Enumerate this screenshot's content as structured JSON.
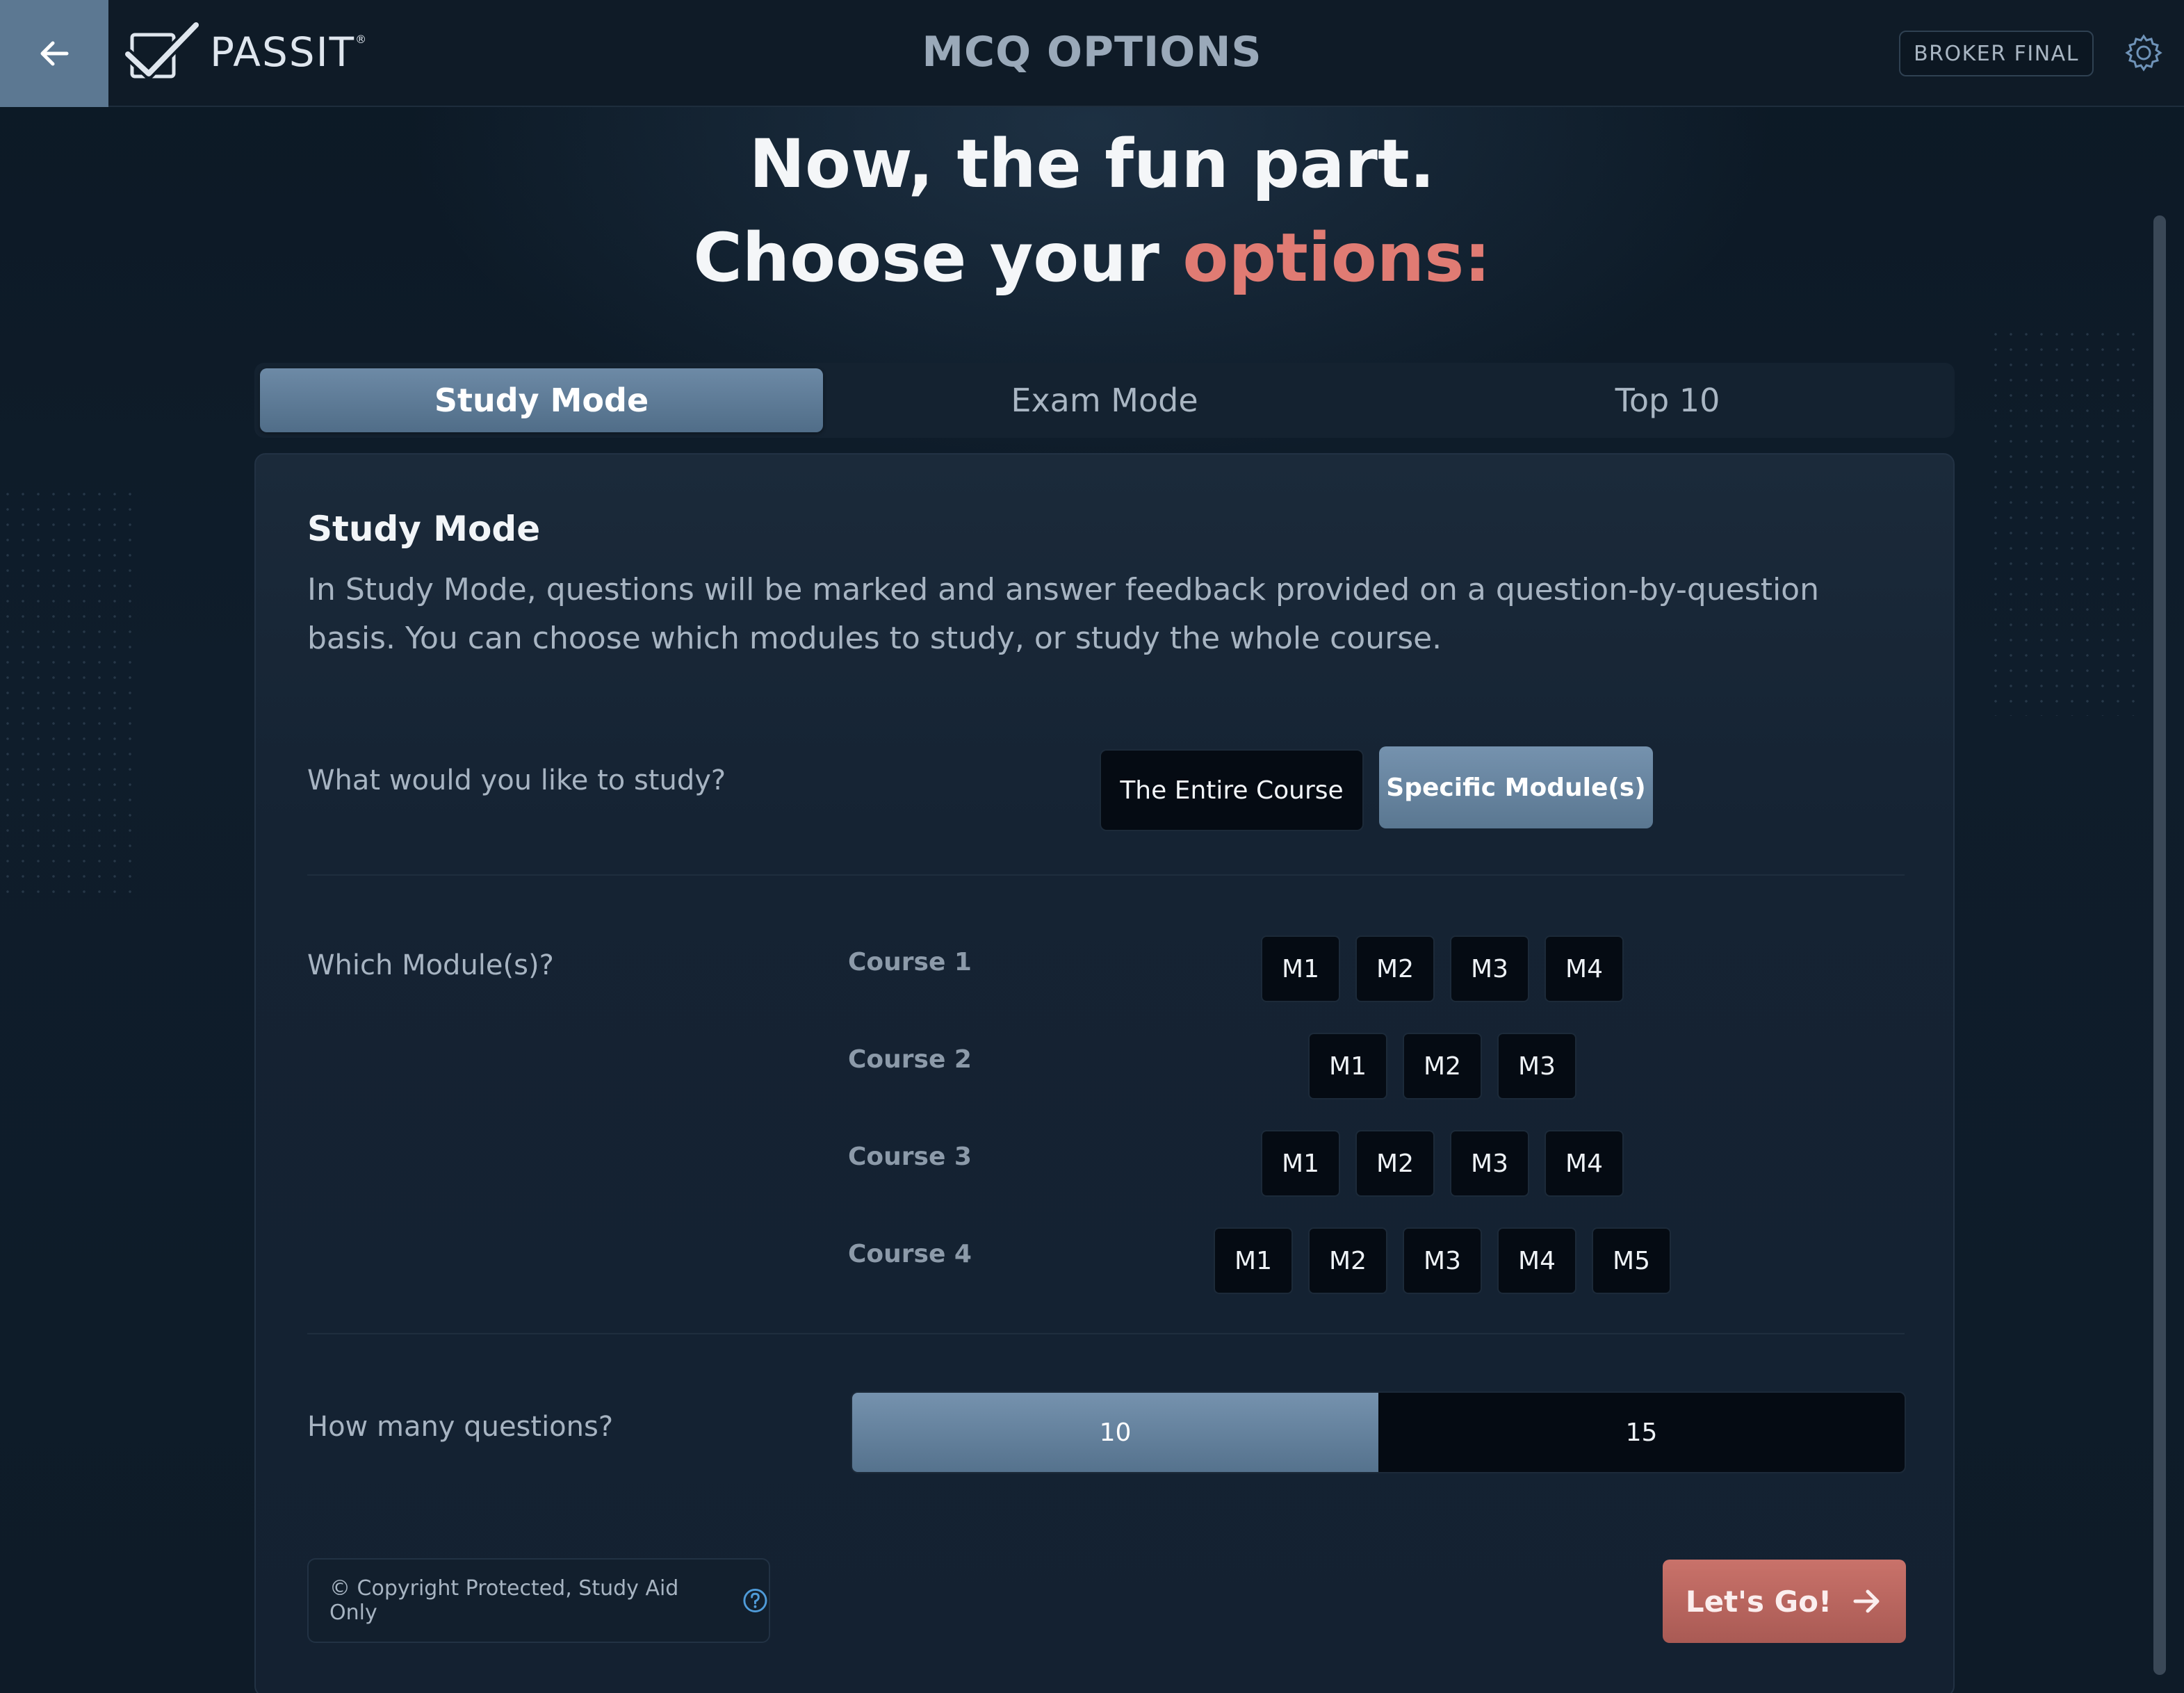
{
  "header": {
    "logo_text": "PASSIT",
    "logo_mark": "®",
    "title": "MCQ OPTIONS",
    "badge": "BROKER FINAL",
    "icons": {
      "back": "arrow-left-icon",
      "settings": "gear-icon",
      "logo": "checkmark-logo-icon"
    }
  },
  "hero": {
    "line1": "Now, the fun part.",
    "line2_prefix": "Choose your ",
    "line2_accent": "options:",
    "accent_color": "#e07b73"
  },
  "tabs": [
    {
      "label": "Study Mode",
      "active": true
    },
    {
      "label": "Exam Mode",
      "active": false
    },
    {
      "label": "Top 10",
      "active": false
    }
  ],
  "panel": {
    "title": "Study Mode",
    "description": "In Study Mode, questions will be marked and answer feedback provided on a question-by-question basis. You can choose which modules to study, or study the whole course.",
    "study_question": "What would you like to study?",
    "study_options": [
      {
        "label": "The Entire Course",
        "selected": false
      },
      {
        "label": "Specific Module(s)",
        "selected": true
      }
    ],
    "modules_question": "Which Module(s)?",
    "courses": [
      {
        "label": "Course 1",
        "modules": [
          "M1",
          "M2",
          "M3",
          "M4"
        ]
      },
      {
        "label": "Course 2",
        "modules": [
          "M1",
          "M2",
          "M3"
        ]
      },
      {
        "label": "Course 3",
        "modules": [
          "M1",
          "M2",
          "M3",
          "M4"
        ]
      },
      {
        "label": "Course 4",
        "modules": [
          "M1",
          "M2",
          "M3",
          "M4",
          "M5"
        ]
      }
    ],
    "count_question": "How many questions?",
    "count_options": [
      {
        "label": "10",
        "selected": true
      },
      {
        "label": "15",
        "selected": false
      }
    ],
    "copyright": "© Copyright Protected, Study Aid Only",
    "go_label": "Let's Go!",
    "icons": {
      "help": "question-circle-icon",
      "go": "arrow-right-icon"
    }
  },
  "colors": {
    "primary_button": "#6a87a3",
    "accent_button": "#c06760",
    "background": "#0d1a26"
  }
}
